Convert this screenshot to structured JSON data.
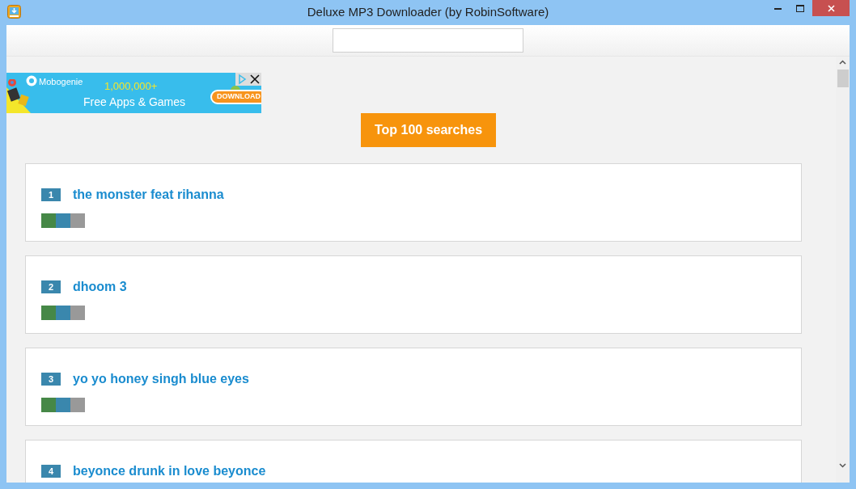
{
  "window": {
    "title": "Deluxe MP3 Downloader (by RobinSoftware)"
  },
  "ad": {
    "brand": "Mobogenie",
    "headline": "1,000,000+",
    "tagline": "Free Apps & Games",
    "button": "DOWNLOAD"
  },
  "top_button": "Top 100 searches",
  "results": [
    {
      "rank": "1",
      "title": "the monster feat rihanna",
      "rating_bar": true
    },
    {
      "rank": "2",
      "title": "dhoom 3",
      "rating_bar": true
    },
    {
      "rank": "3",
      "title": "yo yo honey singh blue eyes",
      "rating_bar": true
    },
    {
      "rank": "4",
      "title": "beyonce drunk in love beyonce"
    }
  ]
}
